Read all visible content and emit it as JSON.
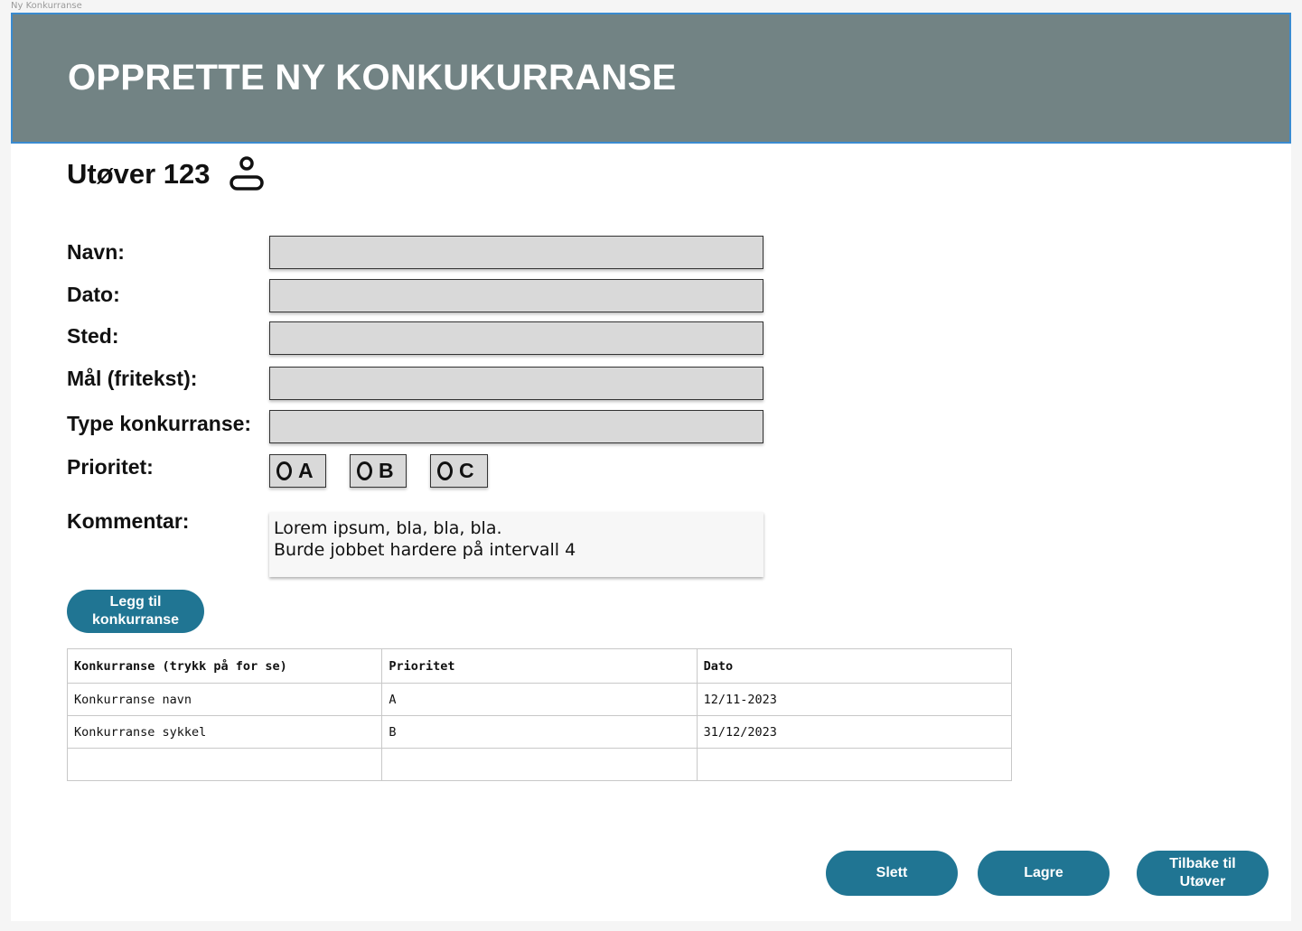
{
  "window": {
    "title": "Ny Konkurranse"
  },
  "header": {
    "title": "OPPRETTE NY KONKUKURRANSE"
  },
  "athlete": {
    "name": "Utøver 123",
    "icon": "user-icon"
  },
  "form": {
    "labels": {
      "name": "Navn:",
      "date": "Dato:",
      "place": "Sted:",
      "goal": "Mål (fritekst):",
      "type": "Type konkurranse:",
      "priority": "Prioritet:",
      "comment": "Kommentar:"
    },
    "values": {
      "name": "",
      "date": "",
      "place": "",
      "goal": "",
      "type": ""
    },
    "priority_options": [
      "A",
      "B",
      "C"
    ],
    "comment_lines": [
      "Lorem ipsum, bla, bla, bla.",
      "Burde jobbet hardere på intervall 4"
    ]
  },
  "add_button": {
    "line1": "Legg til",
    "line2": "konkurranse"
  },
  "table": {
    "headers": [
      "Konkurranse (trykk på for se)",
      "Prioritet",
      "Dato"
    ],
    "rows": [
      [
        "Konkurranse navn",
        "A",
        "12/11-2023"
      ],
      [
        "Konkurranse sykkel",
        "B",
        "31/12/2023"
      ],
      [
        "",
        "",
        ""
      ]
    ]
  },
  "footer": {
    "delete": "Slett",
    "save": "Lagre",
    "back_line1": "Tilbake til",
    "back_line2": "Utøver"
  },
  "colors": {
    "header_bg": "#728384",
    "header_border": "#3a8bd0",
    "button_bg": "#207593",
    "field_bg": "#d9d9d9"
  }
}
